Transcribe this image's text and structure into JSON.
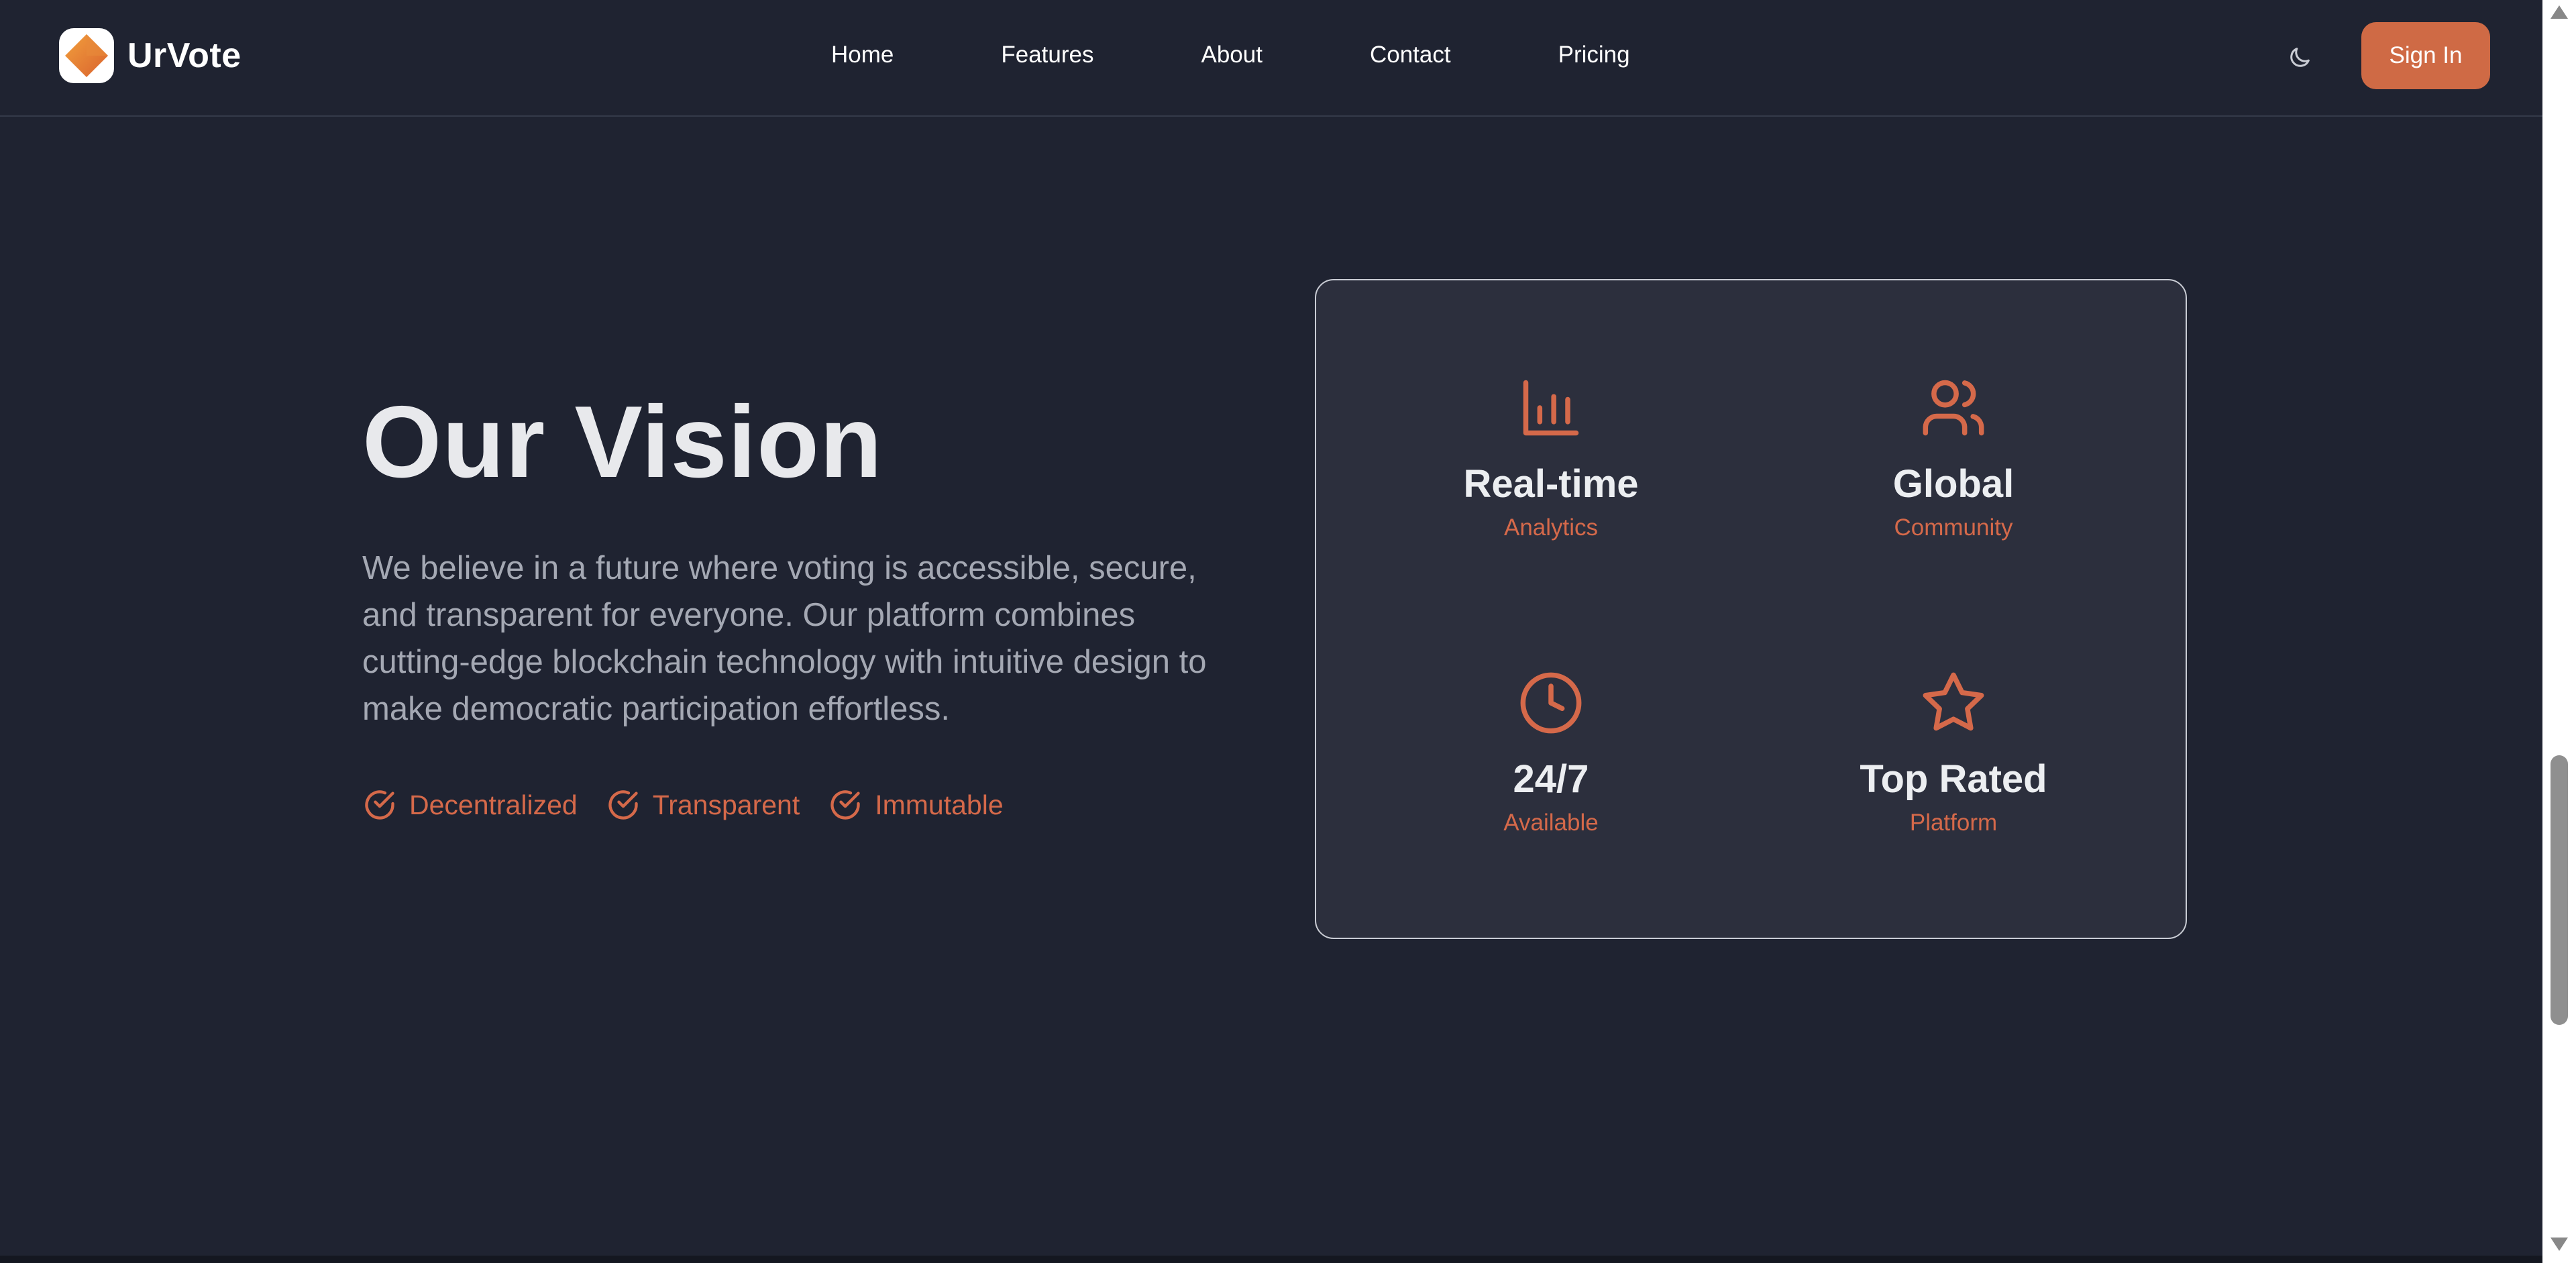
{
  "navbar": {
    "brand": "UrVote",
    "links": [
      "Home",
      "Features",
      "About",
      "Contact",
      "Pricing"
    ],
    "sign_in_label": "Sign In",
    "theme_icon": "moon-icon"
  },
  "vision": {
    "title": "Our Vision",
    "description": "We believe in a future where voting is accessible, secure, and transparent for everyone. Our platform combines cutting-edge blockchain technology with intuitive design to make democratic participation effortless.",
    "badges": [
      "Decentralized",
      "Transparent",
      "Immutable"
    ]
  },
  "stats": [
    {
      "icon": "bar-chart-icon",
      "value": "Real-time",
      "label": "Analytics"
    },
    {
      "icon": "users-icon",
      "value": "Global",
      "label": "Community"
    },
    {
      "icon": "clock-icon",
      "value": "24/7",
      "label": "Available"
    },
    {
      "icon": "star-icon",
      "value": "Top Rated",
      "label": "Platform"
    }
  ],
  "colors": {
    "background": "#1f2331",
    "card": "#2c2f3d",
    "accent": "#cf6a45",
    "text": "#e6e7ea",
    "muted": "#a4a8b3"
  }
}
